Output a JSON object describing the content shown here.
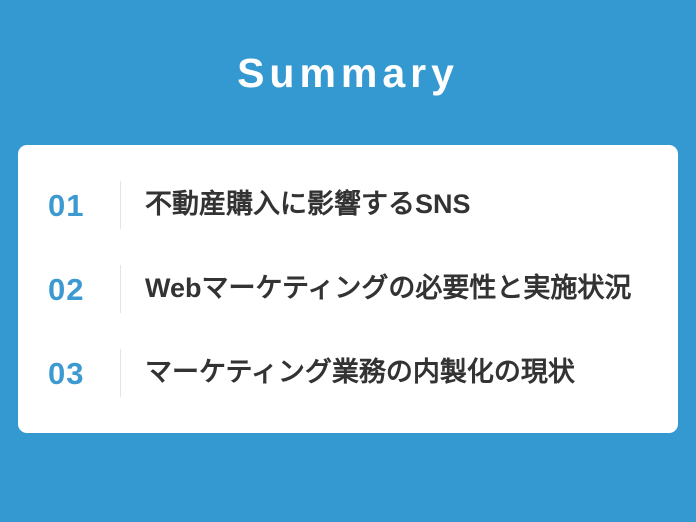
{
  "slide": {
    "background_color": "#3498d1",
    "title": "Summary"
  },
  "card": {
    "background_color": "#ffffff",
    "number_color": "#3d9ad1",
    "text_color": "#333333",
    "divider_color": "#e2e4e6",
    "items": [
      {
        "number": "01",
        "text": "不動産購入に影響するSNS"
      },
      {
        "number": "02",
        "text": "Webマーケティングの必要性と実施状況"
      },
      {
        "number": "03",
        "text": "マーケティング業務の内製化の現状"
      }
    ]
  }
}
